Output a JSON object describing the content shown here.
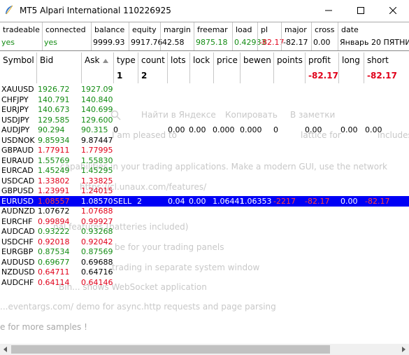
{
  "window": {
    "title": "MT5 Alpari International 110226925"
  },
  "status": {
    "headers": [
      "tradeable",
      "connected",
      "balance",
      "equity",
      "margin",
      "freemar",
      "load",
      "pl",
      "major",
      "cross",
      "date"
    ],
    "values": [
      {
        "text": "yes",
        "color": "#148c14"
      },
      {
        "text": "yes",
        "color": "#148c14"
      },
      {
        "text": "9999.93",
        "color": "#000000"
      },
      {
        "text": "9917.76",
        "color": "#000000"
      },
      {
        "text": "42.58",
        "color": "#000000"
      },
      {
        "text": "9875.18",
        "color": "#148c14"
      },
      {
        "text": "0.42933",
        "color": "#148c14"
      },
      {
        "text": "-82.17",
        "color": "#e0001a"
      },
      {
        "text": "-82.17",
        "color": "#000000"
      },
      {
        "text": "0.00",
        "color": "#000000"
      },
      {
        "text": "Январь 20 ПЯТНИЦ",
        "color": "#000000"
      }
    ]
  },
  "table": {
    "columns": [
      "Symbol",
      "Bid",
      "Ask",
      "type",
      "count",
      "lots",
      "lock",
      "price",
      "bewen",
      "points",
      "profit",
      "long",
      "short"
    ],
    "sort_indicator": "sort-ascending-icon",
    "summary": {
      "type": "1",
      "count": "2",
      "profit": "-82.17",
      "short": "-82.17"
    },
    "rows": [
      {
        "symbol": "XAUUSD",
        "bid": "1926.72",
        "ask": "1927.09",
        "bid_color": "#148c14",
        "ask_color": "#148c14"
      },
      {
        "symbol": "CHFJPY",
        "bid": "140.791",
        "ask": "140.840",
        "bid_color": "#148c14",
        "ask_color": "#148c14"
      },
      {
        "symbol": "EURJPY",
        "bid": "140.673",
        "ask": "140.699",
        "bid_color": "#148c14",
        "ask_color": "#148c14"
      },
      {
        "symbol": "USDJPY",
        "bid": "129.585",
        "ask": "129.600",
        "bid_color": "#148c14",
        "ask_color": "#148c14"
      },
      {
        "symbol": "AUDJPY",
        "bid": "90.294",
        "ask": "90.315",
        "bid_color": "#148c14",
        "ask_color": "#148c14",
        "type": "0",
        "lots": "0.00",
        "lock": "0.00",
        "price": "0.000",
        "bewen": "0.000",
        "points": "0",
        "profit": "0.00",
        "long": "0.00",
        "short": "0.00"
      },
      {
        "symbol": "USDNOK",
        "bid": "9.85934",
        "ask": "9.87447",
        "bid_color": "#148c14",
        "ask_color": "#000000"
      },
      {
        "symbol": "GBPAUD",
        "bid": "1.77911",
        "ask": "1.77995",
        "bid_color": "#e0001a",
        "ask_color": "#e0001a"
      },
      {
        "symbol": "EURAUD",
        "bid": "1.55769",
        "ask": "1.55830",
        "bid_color": "#148c14",
        "ask_color": "#148c14"
      },
      {
        "symbol": "EURCAD",
        "bid": "1.45249",
        "ask": "1.45295",
        "bid_color": "#148c14",
        "ask_color": "#148c14"
      },
      {
        "symbol": "USDCAD",
        "bid": "1.33802",
        "ask": "1.33825",
        "bid_color": "#e0001a",
        "ask_color": "#e0001a"
      },
      {
        "symbol": "GBPUSD",
        "bid": "1.23991",
        "ask": "1.24015",
        "bid_color": "#e0001a",
        "ask_color": "#e0001a"
      },
      {
        "symbol": "EURUSD",
        "bid": "1.08557",
        "ask": "1.08570",
        "bid_color": "#ff4040",
        "ask_color": "#ffffff",
        "selected": true,
        "type": "SELL",
        "count": "2",
        "lots": "0.04",
        "lock": "0.00",
        "price": "1.06441",
        "bewen": "1.06353",
        "points": "-2217",
        "profit": "-82.17",
        "long": "0.00",
        "short": "-82.17"
      },
      {
        "symbol": "AUDNZD",
        "bid": "1.07672",
        "ask": "1.07688",
        "bid_color": "#000000",
        "ask_color": "#e0001a"
      },
      {
        "symbol": "EURCHF",
        "bid": "0.99894",
        "ask": "0.99927",
        "bid_color": "#e0001a",
        "ask_color": "#e0001a"
      },
      {
        "symbol": "AUDCAD",
        "bid": "0.93222",
        "ask": "0.93268",
        "bid_color": "#148c14",
        "ask_color": "#148c14"
      },
      {
        "symbol": "USDCHF",
        "bid": "0.92018",
        "ask": "0.92042",
        "bid_color": "#e0001a",
        "ask_color": "#e0001a"
      },
      {
        "symbol": "EURGBP",
        "bid": "0.87534",
        "ask": "0.87569",
        "bid_color": "#148c14",
        "ask_color": "#148c14"
      },
      {
        "symbol": "AUDUSD",
        "bid": "0.69677",
        "ask": "0.69688",
        "bid_color": "#148c14",
        "ask_color": "#000000"
      },
      {
        "symbol": "NZDUSD",
        "bid": "0.64711",
        "ask": "0.64716",
        "bid_color": "#e0001a",
        "ask_color": "#000000"
      },
      {
        "symbol": "AUDCHF",
        "bid": "0.64114",
        "ask": "0.64146",
        "bid_color": "#e0001a",
        "ask_color": "#e0001a"
      }
    ]
  },
  "ghost_text": [
    "Найти в Яндексе",
    "Копировать",
    "В заметки",
    "I am pleased to",
    "lattice for",
    "includes",
    "capabilities in your trading applications. Make a modern GUI, use the network",
    "https://cl.unaux.com/features/",
    "nal features (batteries included)",
    "be for your trading panels",
    "trading in separate system window",
    "Bin... shows WebSocket application",
    "...eventargs.com/ demo for async.http requests and page parsing",
    "e for more samples !"
  ]
}
